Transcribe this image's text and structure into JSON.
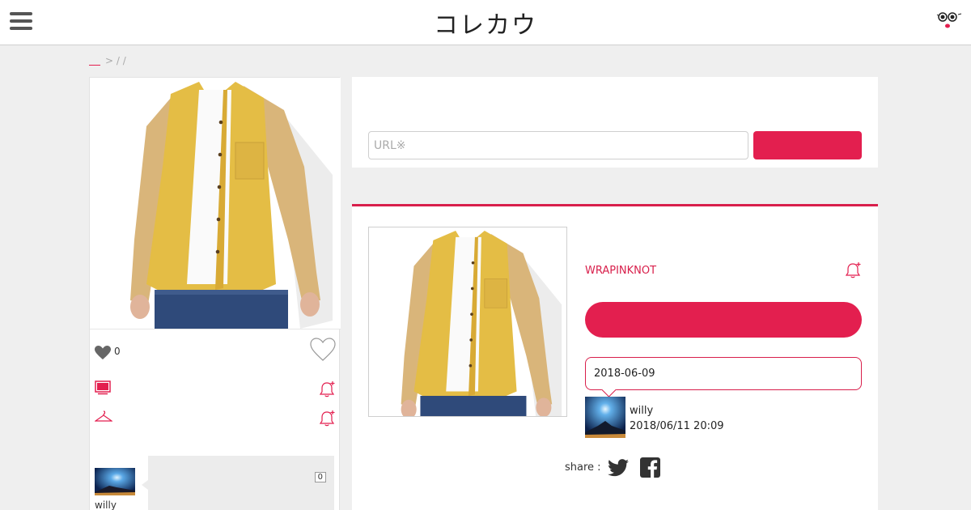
{
  "header": {
    "site_title": "コレカウ"
  },
  "breadcrumb": {
    "separators": [
      "&gt;",
      "/",
      "/"
    ],
    "text": "> / /"
  },
  "left_card": {
    "like_count": "0",
    "commenter_name": "willy",
    "comment_count": "0"
  },
  "url_form": {
    "placeholder": "URL※"
  },
  "detail": {
    "brand": "WRAPINKNOT",
    "date": "2018-06-09",
    "poster_name": "willy",
    "posted_at": "2018/06/11 20:09",
    "share_label": "share :"
  },
  "colors": {
    "accent": "#e31f4f",
    "accent_dark": "#d81f4b",
    "page_bg": "#efefef",
    "jacket_yellow": "#e4bd45",
    "sleeve_tan": "#d9b57a",
    "denim": "#2f4a7a"
  },
  "icons": {
    "menu": "hamburger-icon",
    "mascot": "mascot-icon",
    "like": "heart-icon",
    "like_outline": "heart-outline-icon",
    "tv": "tv-icon",
    "bell": "bell-plus-icon",
    "hanger": "hanger-icon",
    "twitter": "twitter-icon",
    "facebook": "facebook-icon"
  }
}
